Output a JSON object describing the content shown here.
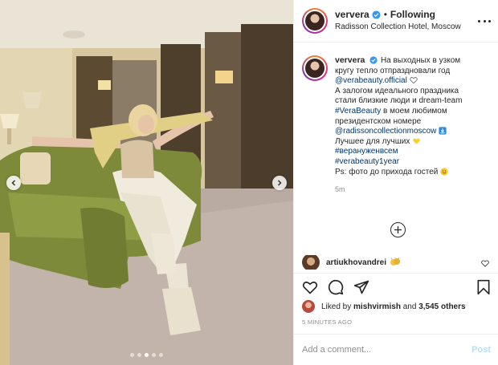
{
  "post": {
    "username": "ververa",
    "follow_status": "Following",
    "separator": "•",
    "location": "Radisson Collection Hotel, Moscow",
    "caption_lines": [
      "На выходных в узком",
      "кругу тепло отпраздновали год",
      "@verabeauty.official",
      "А залогом идеального праздника",
      "стали близкие люди и dream-team",
      "#VeraBeauty",
      " в моем любимом",
      "президентском номере",
      "@radissoncollectionmoscow",
      "Лучшее для лучших",
      "#верануженвсем",
      "#verabeauty1year",
      "Ps: фото до прихода гостей"
    ],
    "caption_time": "5m",
    "comment": {
      "username": "artiukhovandrei"
    },
    "likes": {
      "prefix": "Liked by",
      "liker": "mishvirmish",
      "and": "and",
      "count": "3,545 others"
    },
    "time_ago": "5 MINUTES AGO",
    "add_comment_placeholder": "Add a comment...",
    "post_button": "Post"
  },
  "icons": {
    "verified": "verified-badge-icon",
    "more": "more-options-icon",
    "load_more": "plus-circle-icon",
    "like": "heart-icon",
    "comment": "comment-icon",
    "share": "share-icon",
    "save": "bookmark-icon",
    "prev": "chevron-left-icon",
    "next": "chevron-right-icon"
  },
  "colors": {
    "link": "#00376b",
    "muted": "#8e8e8e",
    "verified": "#3897f0",
    "post_disabled": "#b2dffc"
  },
  "carousel": {
    "count": 5,
    "active": 2
  }
}
